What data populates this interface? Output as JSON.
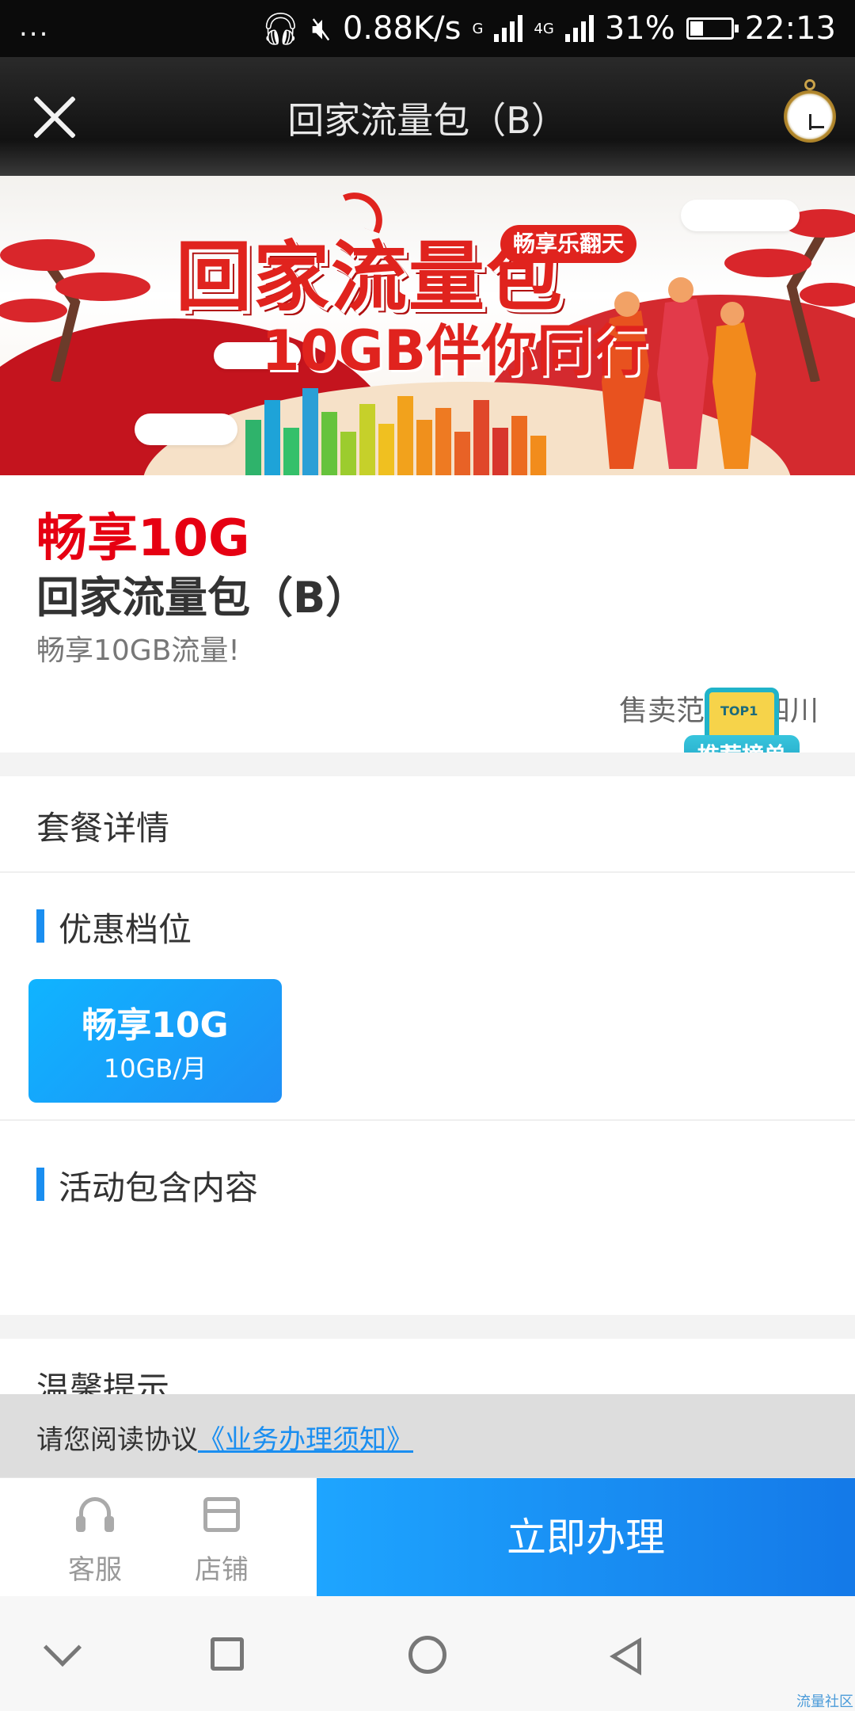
{
  "status_bar": {
    "dots": "...",
    "speed": "0.88K/s",
    "network1": "G",
    "network2": "4G",
    "battery": "31%",
    "time": "22:13"
  },
  "header": {
    "title": "回家流量包（B）"
  },
  "banner": {
    "title": "回家流量包",
    "tag": "畅享乐翻天",
    "subtitle": "10GB伴你同行"
  },
  "product": {
    "price_title": "畅享10G",
    "name": "回家流量包（B）",
    "description": "畅享10GB流量!",
    "sales_area": "售卖范围：四川"
  },
  "badge": {
    "screen_text": "TOP1",
    "label": "推荐榜单"
  },
  "details": {
    "heading": "套餐详情",
    "tier_heading": "优惠档位",
    "tier": {
      "name": "畅享10G",
      "amount": "10GB/月"
    },
    "content_heading": "活动包含内容"
  },
  "tips": {
    "heading": "温馨提示"
  },
  "agreement": {
    "prefix": "请您阅读协议",
    "link": "《业务办理须知》"
  },
  "actions": {
    "service_label": "客服",
    "shop_label": "店铺",
    "buy_label": "立即办理"
  },
  "watermark": "流量社区",
  "colors": {
    "accent": "#1a8ef0",
    "price_red": "#e60012",
    "buy_button": "#1e8ff5"
  }
}
